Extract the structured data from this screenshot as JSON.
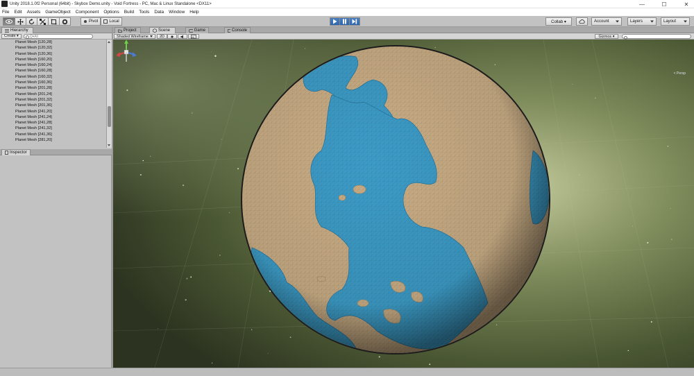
{
  "window": {
    "title": "Unity 2018.1.0f2 Personal (64bit) - Skybox Demo.unity - Void Fortress - PC, Mac & Linux Standalone <DX11>",
    "controls": {
      "minimize": "—",
      "maximize": "☐",
      "close": "✕"
    }
  },
  "menu": [
    "File",
    "Edit",
    "Assets",
    "GameObject",
    "Component",
    "Options",
    "Build",
    "Tools",
    "Data",
    "Window",
    "Help"
  ],
  "toolbar": {
    "pivot_label": "Pivot",
    "local_label": "Local",
    "collab_label": "Collab ▾",
    "account_label": "Account",
    "layers_label": "Layers",
    "layout_label": "Layout"
  },
  "hierarchy": {
    "tab_label": "Hierarchy",
    "create_label": "Create ▾",
    "search_placeholder": "Q▾All",
    "items": [
      "Planet Mesh [120,28]",
      "Planet Mesh [120,32]",
      "Planet Mesh [120,36]",
      "Planet Mesh [160,20]",
      "Planet Mesh [160,24]",
      "Planet Mesh [160,28]",
      "Planet Mesh [160,32]",
      "Planet Mesh [160,36]",
      "Planet Mesh [201,28]",
      "Planet Mesh [201,24]",
      "Planet Mesh [201,32]",
      "Planet Mesh [201,36]",
      "Planet Mesh [241,20]",
      "Planet Mesh [241,24]",
      "Planet Mesh [241,28]",
      "Planet Mesh [241,32]",
      "Planet Mesh [241,36]",
      "Planet Mesh [281,20]"
    ]
  },
  "inspector": {
    "tab_label": "Inspector"
  },
  "scene": {
    "tabs": [
      "Project",
      "Scene",
      "Game",
      "Console"
    ],
    "active_tab": "Scene",
    "shading_label": "Shaded Wireframe",
    "mode_2d_label": "2D",
    "gizmos_label": "Gizmos ▾",
    "projection_label": "< Persp"
  },
  "colors": {
    "ocean": "#3d9cc7",
    "land": "#c9ad85",
    "space": "#3e4a2c",
    "play_accent": "#2f66ad"
  }
}
